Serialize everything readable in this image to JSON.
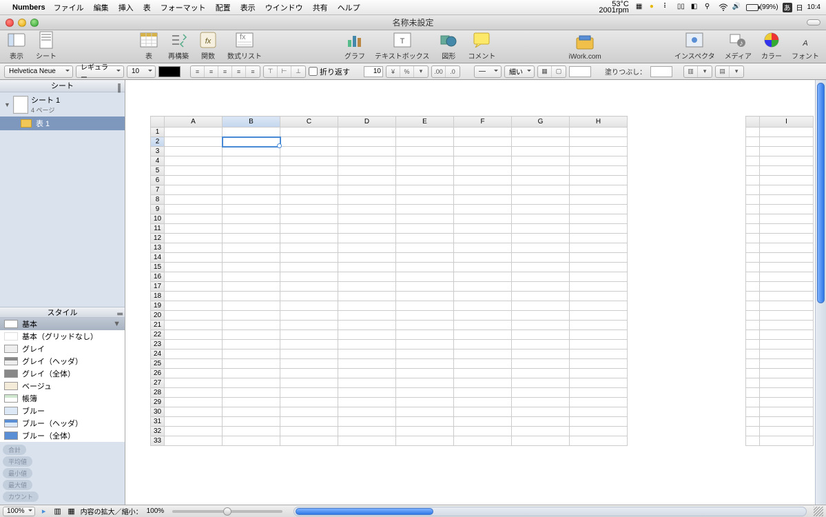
{
  "menubar": {
    "app": "Numbers",
    "items": [
      "ファイル",
      "編集",
      "挿入",
      "表",
      "フォーマット",
      "配置",
      "表示",
      "ウインドウ",
      "共有",
      "ヘルプ"
    ],
    "temp_line1": "53°C",
    "temp_line2": "2001rpm",
    "battery": "(99%)",
    "ime": "あ",
    "day": "日",
    "time": "10:4"
  },
  "window": {
    "title": "名称未設定"
  },
  "toolbar": {
    "left": [
      {
        "name": "view",
        "label": "表示"
      },
      {
        "name": "sheet",
        "label": "シート"
      }
    ],
    "mid1": [
      {
        "name": "table",
        "label": "表"
      },
      {
        "name": "reorg",
        "label": "再構築"
      },
      {
        "name": "func",
        "label": "関数"
      },
      {
        "name": "formulas",
        "label": "数式リスト"
      }
    ],
    "mid2": [
      {
        "name": "chart",
        "label": "グラフ"
      },
      {
        "name": "textbox",
        "label": "テキストボックス"
      },
      {
        "name": "shape",
        "label": "図形"
      },
      {
        "name": "comment",
        "label": "コメント"
      }
    ],
    "mid3": [
      {
        "name": "iwork",
        "label": "iWork.com"
      }
    ],
    "right": [
      {
        "name": "inspector",
        "label": "インスペクタ"
      },
      {
        "name": "media",
        "label": "メディア"
      },
      {
        "name": "color",
        "label": "カラー"
      },
      {
        "name": "font",
        "label": "フォント"
      }
    ]
  },
  "fmt": {
    "font": "Helvetica Neue",
    "weight": "レギュラー",
    "size": "10",
    "wrap_label": "折り返す",
    "num_field": "10",
    "currency": "¥",
    "percent": "%",
    "dec1": ".00",
    "dec2": ".0",
    "stroke": "細い",
    "fill_label": "塗りつぶし："
  },
  "sidebar": {
    "sheets_header": "シート",
    "sheet_name": "シート 1",
    "sheet_pages": "4 ページ",
    "table_name": "表 1",
    "styles_header": "スタイル",
    "styles": [
      "基本",
      "基本（グリッドなし）",
      "グレイ",
      "グレイ（ヘッダ）",
      "グレイ（全体）",
      "ベージュ",
      "帳簿",
      "ブルー",
      "ブルー（ヘッダ）",
      "ブルー（全体）"
    ],
    "pills": [
      "合計",
      "平均値",
      "最小値",
      "最大値",
      "カウント"
    ]
  },
  "sheet": {
    "cols": [
      "A",
      "B",
      "C",
      "D",
      "E",
      "F",
      "G",
      "H"
    ],
    "rows": 33,
    "selected_cell": "B2",
    "overflow_cols": [
      "I"
    ]
  },
  "footer": {
    "zoom": "100%",
    "scale_label": "内容の拡大／縮小：",
    "scale_value": "100%"
  }
}
